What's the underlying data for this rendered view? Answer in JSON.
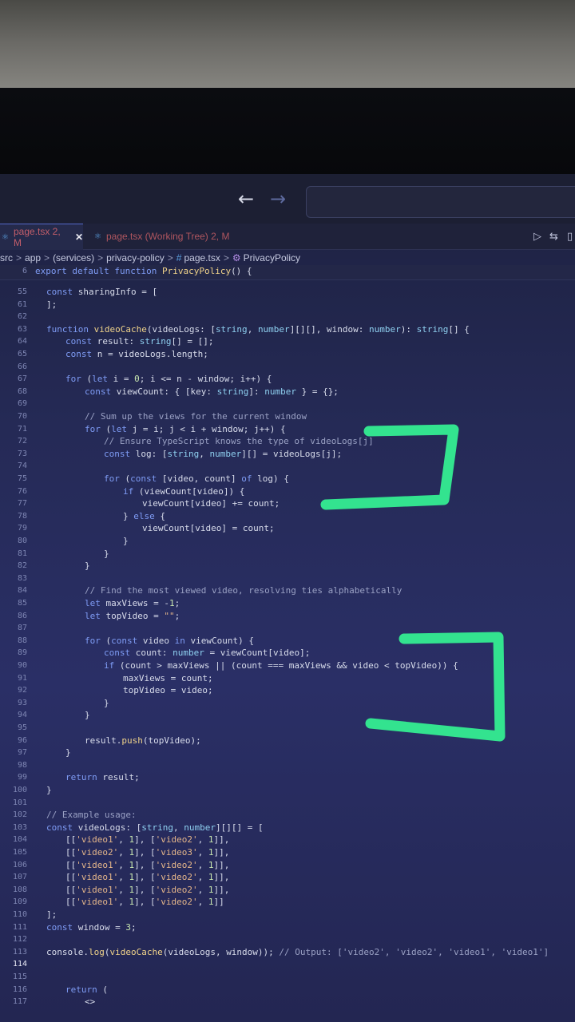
{
  "nav": {
    "back_icon": "arrow-left-icon",
    "forward_icon": "arrow-right-icon"
  },
  "tabs": [
    {
      "label": "page.tsx 2, M",
      "close": "✕",
      "active": true
    },
    {
      "label": "page.tsx (Working Tree) 2, M",
      "active": false
    }
  ],
  "breadcrumb": [
    "src",
    "app",
    "(services)",
    "privacy-policy",
    "page.tsx",
    "PrivacyPolicy"
  ],
  "sticky": {
    "ln": "6",
    "text": "export default function PrivacyPolicy() {"
  },
  "lines": [
    {
      "ln": "55",
      "text": "const sharingInfo = [",
      "indent": 0
    },
    {
      "ln": "61",
      "text": "];",
      "indent": 0
    },
    {
      "ln": "62",
      "text": "",
      "indent": 0
    },
    {
      "ln": "63",
      "text": "function videoCache(videoLogs: [string, number][][], window: number): string[] {",
      "indent": 0
    },
    {
      "ln": "64",
      "text": "const result: string[] = [];",
      "indent": 1
    },
    {
      "ln": "65",
      "text": "const n = videoLogs.length;",
      "indent": 1
    },
    {
      "ln": "66",
      "text": "",
      "indent": 0
    },
    {
      "ln": "67",
      "text": "for (let i = 0; i <= n - window; i++) {",
      "indent": 1
    },
    {
      "ln": "68",
      "text": "const viewCount: { [key: string]: number } = {};",
      "indent": 2
    },
    {
      "ln": "69",
      "text": "",
      "indent": 0
    },
    {
      "ln": "70",
      "text": "// Sum up the views for the current window",
      "indent": 2
    },
    {
      "ln": "71",
      "text": "for (let j = i; j < i + window; j++) {",
      "indent": 2
    },
    {
      "ln": "72",
      "text": "// Ensure TypeScript knows the type of videoLogs[j]",
      "indent": 3
    },
    {
      "ln": "73",
      "text": "const log: [string, number][] = videoLogs[j];",
      "indent": 3
    },
    {
      "ln": "74",
      "text": "",
      "indent": 0
    },
    {
      "ln": "75",
      "text": "for (const [video, count] of log) {",
      "indent": 3
    },
    {
      "ln": "76",
      "text": "if (viewCount[video]) {",
      "indent": 4
    },
    {
      "ln": "77",
      "text": "viewCount[video] += count;",
      "indent": 5
    },
    {
      "ln": "78",
      "text": "} else {",
      "indent": 4
    },
    {
      "ln": "79",
      "text": "viewCount[video] = count;",
      "indent": 5
    },
    {
      "ln": "80",
      "text": "}",
      "indent": 4
    },
    {
      "ln": "81",
      "text": "}",
      "indent": 3
    },
    {
      "ln": "82",
      "text": "}",
      "indent": 2
    },
    {
      "ln": "83",
      "text": "",
      "indent": 0
    },
    {
      "ln": "84",
      "text": "// Find the most viewed video, resolving ties alphabetically",
      "indent": 2
    },
    {
      "ln": "85",
      "text": "let maxViews = -1;",
      "indent": 2
    },
    {
      "ln": "86",
      "text": "let topVideo = \"\";",
      "indent": 2
    },
    {
      "ln": "87",
      "text": "",
      "indent": 0
    },
    {
      "ln": "88",
      "text": "for (const video in viewCount) {",
      "indent": 2
    },
    {
      "ln": "89",
      "text": "const count: number = viewCount[video];",
      "indent": 3
    },
    {
      "ln": "90",
      "text": "if (count > maxViews || (count === maxViews && video < topVideo)) {",
      "indent": 3
    },
    {
      "ln": "91",
      "text": "maxViews = count;",
      "indent": 4
    },
    {
      "ln": "92",
      "text": "topVideo = video;",
      "indent": 4
    },
    {
      "ln": "93",
      "text": "}",
      "indent": 3
    },
    {
      "ln": "94",
      "text": "}",
      "indent": 2
    },
    {
      "ln": "95",
      "text": "",
      "indent": 0
    },
    {
      "ln": "96",
      "text": "result.push(topVideo);",
      "indent": 2
    },
    {
      "ln": "97",
      "text": "}",
      "indent": 1
    },
    {
      "ln": "98",
      "text": "",
      "indent": 0
    },
    {
      "ln": "99",
      "text": "return result;",
      "indent": 1
    },
    {
      "ln": "100",
      "text": "}",
      "indent": 0
    },
    {
      "ln": "101",
      "text": "",
      "indent": 0
    },
    {
      "ln": "102",
      "text": "// Example usage:",
      "indent": 0
    },
    {
      "ln": "103",
      "text": "const videoLogs: [string, number][][] = [",
      "indent": 0
    },
    {
      "ln": "104",
      "text": "[['video1', 1], ['video2', 1]],",
      "indent": 1
    },
    {
      "ln": "105",
      "text": "[['video2', 1], ['video3', 1]],",
      "indent": 1
    },
    {
      "ln": "106",
      "text": "[['video1', 1], ['video2', 1]],",
      "indent": 1
    },
    {
      "ln": "107",
      "text": "[['video1', 1], ['video2', 1]],",
      "indent": 1
    },
    {
      "ln": "108",
      "text": "[['video1', 1], ['video2', 1]],",
      "indent": 1
    },
    {
      "ln": "109",
      "text": "[['video1', 1], ['video2', 1]]",
      "indent": 1
    },
    {
      "ln": "110",
      "text": "];",
      "indent": 0
    },
    {
      "ln": "111",
      "text": "const window = 3;",
      "indent": 0
    },
    {
      "ln": "112",
      "text": "",
      "indent": 0
    },
    {
      "ln": "113",
      "text": "console.log(videoCache(videoLogs, window)); // Output: ['video2', 'video2', 'video1', 'video1']",
      "indent": 0
    },
    {
      "ln": "114",
      "text": "",
      "indent": 0,
      "current": true
    },
    {
      "ln": "115",
      "text": "",
      "indent": 0
    },
    {
      "ln": "116",
      "text": "return (",
      "indent": 1
    },
    {
      "ln": "117",
      "text": "<>",
      "indent": 2
    }
  ],
  "colors": {
    "marker": "#33e38f",
    "keyword": "#7f9cf5",
    "function": "#f0d38a"
  }
}
